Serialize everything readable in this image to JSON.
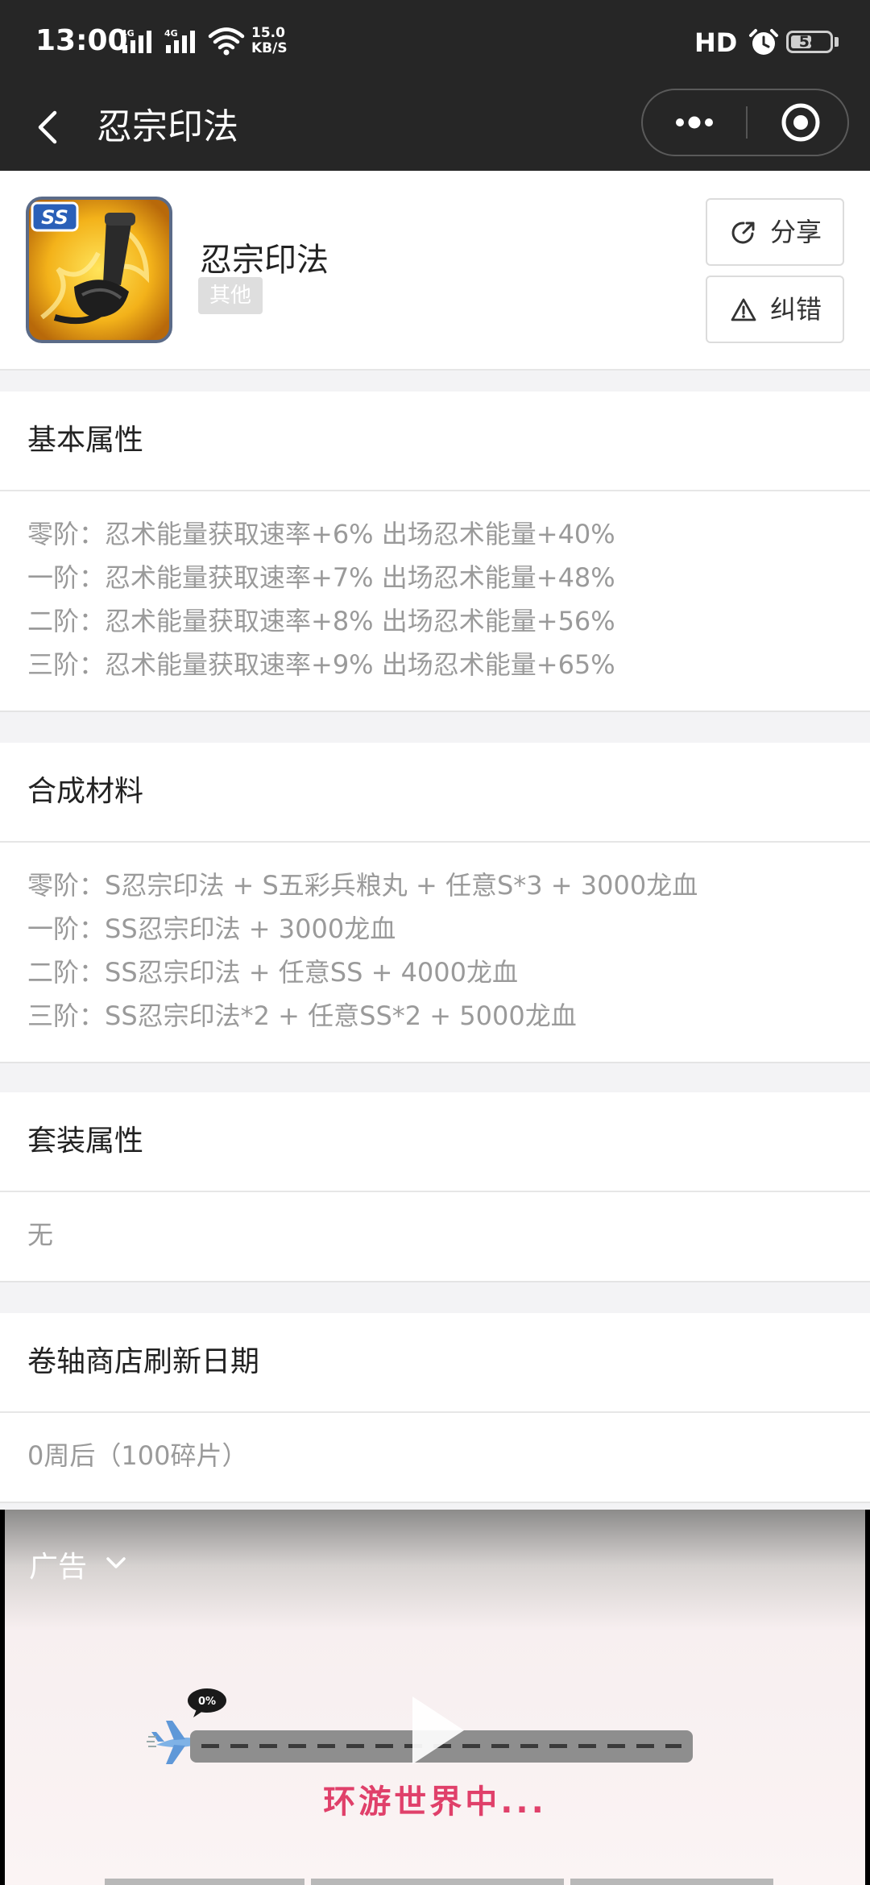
{
  "status_bar": {
    "time": "13:00",
    "network1": "4G",
    "network2": "4G",
    "speed_value": "15.0",
    "speed_unit": "KB/S",
    "hd": "HD",
    "battery": "54",
    "battery_level": 0.54
  },
  "nav": {
    "title": "忍宗印法"
  },
  "item": {
    "name": "忍宗印法",
    "tag": "其他",
    "icon_badge": "SS",
    "share_label": "分享",
    "report_label": "纠错"
  },
  "sections": [
    {
      "title": "基本属性",
      "lines": [
        "零阶：忍术能量获取速率+6% 出场忍术能量+40%",
        "一阶：忍术能量获取速率+7% 出场忍术能量+48%",
        "二阶：忍术能量获取速率+8% 出场忍术能量+56%",
        "三阶：忍术能量获取速率+9% 出场忍术能量+65%"
      ]
    },
    {
      "title": "合成材料",
      "lines": [
        "零阶：S忍宗印法 + S五彩兵粮丸 + 任意S*3 + 3000龙血",
        "一阶：SS忍宗印法 + 3000龙血",
        "二阶：SS忍宗印法 + 任意SS + 4000龙血",
        "三阶：SS忍宗印法*2 + 任意SS*2 + 5000龙血"
      ]
    },
    {
      "title": "套装属性",
      "lines": [
        "无"
      ]
    },
    {
      "title": "卷轴商店刷新日期",
      "lines": [
        "0周后（100碎片）"
      ]
    }
  ],
  "ad": {
    "label": "广告",
    "text": "环游世界中...",
    "bubble": "0%"
  },
  "colors": {
    "top_bar": "#262626",
    "page_bg": "#f3f3f5",
    "muted_text": "#9a9a9a",
    "ad_text": "#e0406a"
  }
}
